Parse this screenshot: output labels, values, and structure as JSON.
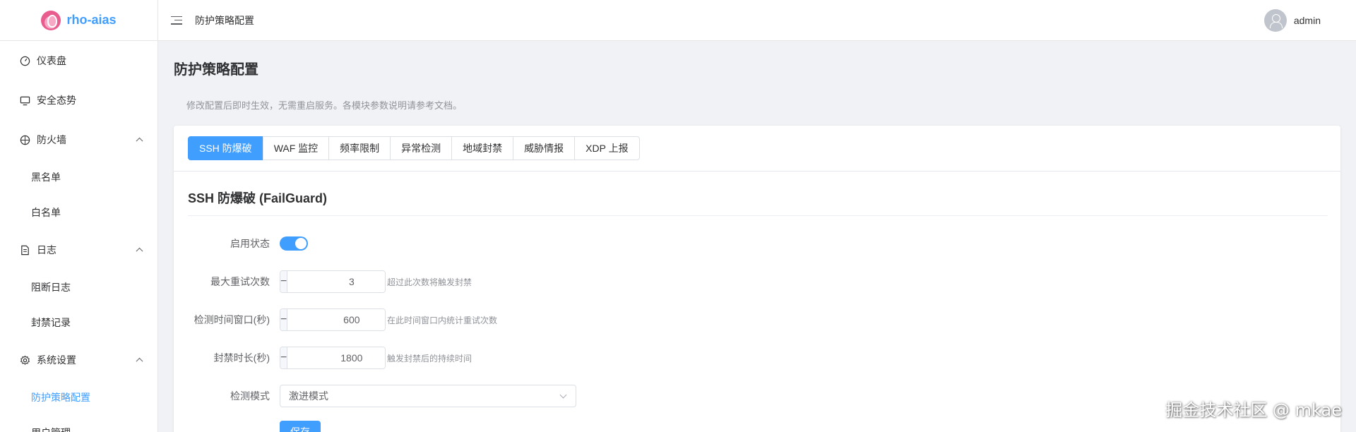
{
  "app": {
    "name": "rho-aias"
  },
  "sidebar": {
    "items": [
      {
        "label": "仪表盘",
        "icon": "gauge-icon"
      },
      {
        "label": "安全态势",
        "icon": "monitor-icon"
      },
      {
        "label": "防火墙",
        "icon": "shield-icon",
        "expanded": true,
        "children": [
          {
            "label": "黑名单"
          },
          {
            "label": "白名单"
          }
        ]
      },
      {
        "label": "日志",
        "icon": "document-icon",
        "expanded": true,
        "children": [
          {
            "label": "阻断日志"
          },
          {
            "label": "封禁记录"
          }
        ]
      },
      {
        "label": "系统设置",
        "icon": "gear-icon",
        "expanded": true,
        "children": [
          {
            "label": "防护策略配置",
            "active": true
          },
          {
            "label": "用户管理"
          }
        ]
      }
    ]
  },
  "header": {
    "breadcrumb": "防护策略配置",
    "user": "admin"
  },
  "page": {
    "title": "防护策略配置",
    "description": "修改配置后即时生效，无需重启服务。各模块参数说明请参考文档。"
  },
  "tabs": [
    {
      "label": "SSH 防爆破",
      "active": true
    },
    {
      "label": "WAF 监控"
    },
    {
      "label": "频率限制"
    },
    {
      "label": "异常检测"
    },
    {
      "label": "地域封禁"
    },
    {
      "label": "威胁情报"
    },
    {
      "label": "XDP 上报"
    }
  ],
  "section": {
    "title": "SSH 防爆破 (FailGuard)",
    "enable_label": "启用状态",
    "enabled": true,
    "max_retry": {
      "label": "最大重试次数",
      "value": "3",
      "hint": "超过此次数将触发封禁"
    },
    "window": {
      "label": "检测时间窗口(秒)",
      "value": "600",
      "hint": "在此时间窗口内统计重试次数"
    },
    "ban_duration": {
      "label": "封禁时长(秒)",
      "value": "1800",
      "hint": "触发封禁后的持续时间"
    },
    "mode": {
      "label": "检测模式",
      "value": "激进模式"
    },
    "save_label": "保存"
  },
  "stepper": {
    "minus": "−",
    "plus": "+"
  },
  "watermark": "掘金技术社区 @ mkae",
  "colors": {
    "primary": "#409eff",
    "logo": "#e85d8e"
  }
}
